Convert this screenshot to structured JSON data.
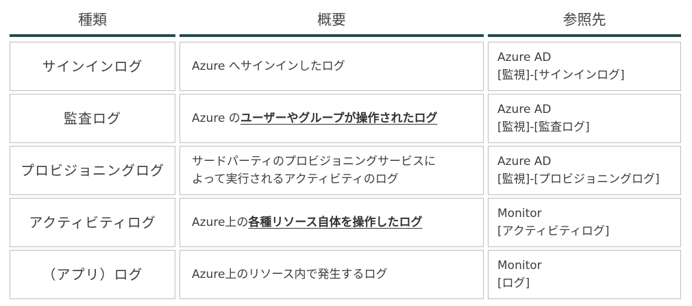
{
  "headers": {
    "type": "種類",
    "summary": "概要",
    "reference": "参照先"
  },
  "rows": [
    {
      "type": "サインインログ",
      "summary_pre": "Azure へサインインしたログ",
      "summary_emph": "",
      "summary_post": "",
      "ref_line1": "Azure AD",
      "ref_line2": "[監視]-[サインインログ]"
    },
    {
      "type": "監査ログ",
      "summary_pre": "Azure の",
      "summary_emph": "ユーザーやグループが操作されたログ",
      "summary_post": "",
      "ref_line1": "Azure AD",
      "ref_line2": "[監視]-[監査ログ]"
    },
    {
      "type": "プロビジョニングログ",
      "summary_line1": "サードパーティのプロビジョニングサービスに",
      "summary_line2": "よって実行されるアクティビティのログ",
      "ref_line1": "Azure AD",
      "ref_line2": "[監視]-[プロビジョニングログ]"
    },
    {
      "type": "アクティビティログ",
      "summary_pre": "Azure上の",
      "summary_emph": "各種リソース自体を操作したログ",
      "summary_post": "",
      "ref_line1": "Monitor",
      "ref_line2": "[アクティビティログ]"
    },
    {
      "type": "（アプリ）ログ",
      "summary_pre": "Azure上のリソース内で発生するログ",
      "summary_emph": "",
      "summary_post": "",
      "ref_line1": "Monitor",
      "ref_line2": "[ログ]"
    }
  ]
}
